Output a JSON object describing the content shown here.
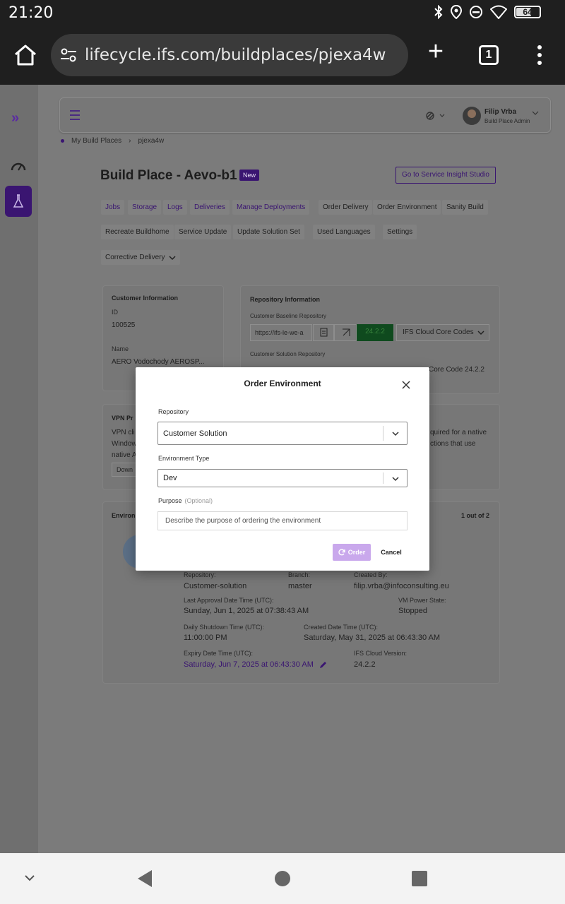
{
  "status_bar": {
    "time": "21:20",
    "battery": "64"
  },
  "browser": {
    "url": "lifecycle.ifs.com/buildplaces/pjexa4w",
    "tab_count": "1"
  },
  "header": {
    "user_name": "Filip Vrba",
    "user_role": "Build Place Admin"
  },
  "breadcrumb": {
    "root": "My Build Places",
    "current": "pjexa4w"
  },
  "page": {
    "title": "Build Place - Aevo-b1",
    "badge": "New",
    "studio_button": "Go to Service Insight Studio"
  },
  "tabs": {
    "jobs": "Jobs",
    "storage": "Storage",
    "logs": "Logs",
    "deliveries": "Deliveries",
    "manage_deployments": "Manage Deployments",
    "order_delivery": "Order Delivery",
    "order_environment": "Order Environment",
    "sanity_build": "Sanity Build",
    "recreate_buildhome": "Recreate Buildhome",
    "service_update": "Service Update",
    "update_solution_set": "Update Solution Set",
    "used_languages": "Used Languages",
    "settings": "Settings",
    "corrective_delivery": "Corrective Delivery"
  },
  "customer_info": {
    "title": "Customer Information",
    "id_label": "ID",
    "id_value": "100525",
    "name_label": "Name",
    "name_value": "AERO Vodochody AEROSP..."
  },
  "repo_info": {
    "title": "Repository Information",
    "baseline_label": "Customer Baseline Repository",
    "baseline_url": "https://ifs-le-we-a",
    "baseline_version": "24.2.2",
    "baseline_select": "IFS Cloud Core Codes",
    "solution_label": "Customer Solution Repository",
    "solution_select": "Core Code 24.2.2"
  },
  "vpn": {
    "title": "VPN Pr",
    "text_left_1": "VPN cli",
    "text_left_2": "Window",
    "text_left_3": "native A",
    "button": "Down",
    "text_right_1": "quired for a native",
    "text_right_2": "ctions that use"
  },
  "environments": {
    "title": "Environ",
    "count": "1 out of 2",
    "repository_label": "Repository:",
    "repository_value": "Customer-solution",
    "branch_label": "Branch:",
    "branch_value": "master",
    "created_by_label": "Created By:",
    "created_by_value": "filip.vrba@infoconsulting.eu",
    "last_approval_label": "Last Approval Date Time (UTC):",
    "last_approval_value": "Sunday, Jun 1, 2025 at 07:38:43 AM",
    "vm_state_label": "VM Power State:",
    "vm_state_value": "Stopped",
    "shutdown_label": "Daily Shutdown Time (UTC):",
    "shutdown_value": "11:00:00 PM",
    "created_label": "Created Date Time (UTC):",
    "created_value": "Saturday, May 31, 2025 at 06:43:30 AM",
    "expiry_label": "Expiry Date Time (UTC):",
    "expiry_value": "Saturday, Jun 7, 2025 at 06:43:30 AM",
    "version_label": "IFS Cloud Version:",
    "version_value": "24.2.2"
  },
  "modal": {
    "title": "Order Environment",
    "repository_label": "Repository",
    "repository_value": "Customer Solution",
    "env_type_label": "Environment Type",
    "env_type_value": "Dev",
    "purpose_label": "Purpose",
    "purpose_optional": "(Optional)",
    "purpose_placeholder": "Describe the purpose of ordering the environment",
    "order_button": "Order",
    "cancel_button": "Cancel"
  }
}
